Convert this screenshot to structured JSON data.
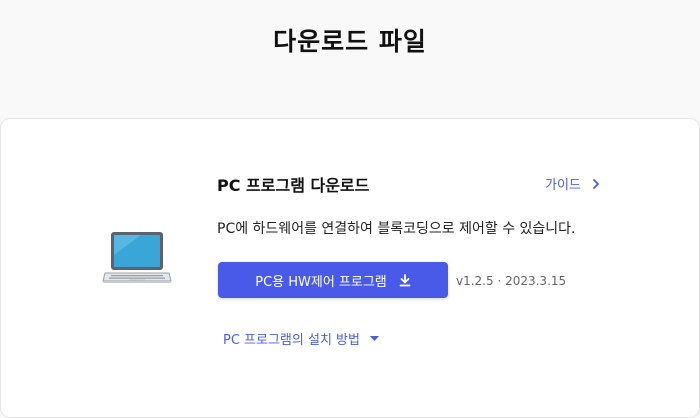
{
  "page": {
    "title": "다운로드 파일"
  },
  "card": {
    "section_title": "PC 프로그램 다운로드",
    "guide_link": "가이드",
    "description": "PC에 하드웨어를 연결하여 블록코딩으로 제어할 수 있습니다.",
    "download_button": "PC용 HW제어 프로그램",
    "version_info": "v1.2.5 · 2023.3.15",
    "install_toggle": "PC 프로그램의 설치 방법",
    "icons": {
      "device": "laptop-icon",
      "guide": "chevron-right-icon",
      "download": "download-icon",
      "toggle": "caret-down-icon"
    }
  },
  "colors": {
    "accent": "#4a5ae8",
    "link": "#4a5de8",
    "background": "#f9f9f9",
    "card": "#ffffff"
  }
}
